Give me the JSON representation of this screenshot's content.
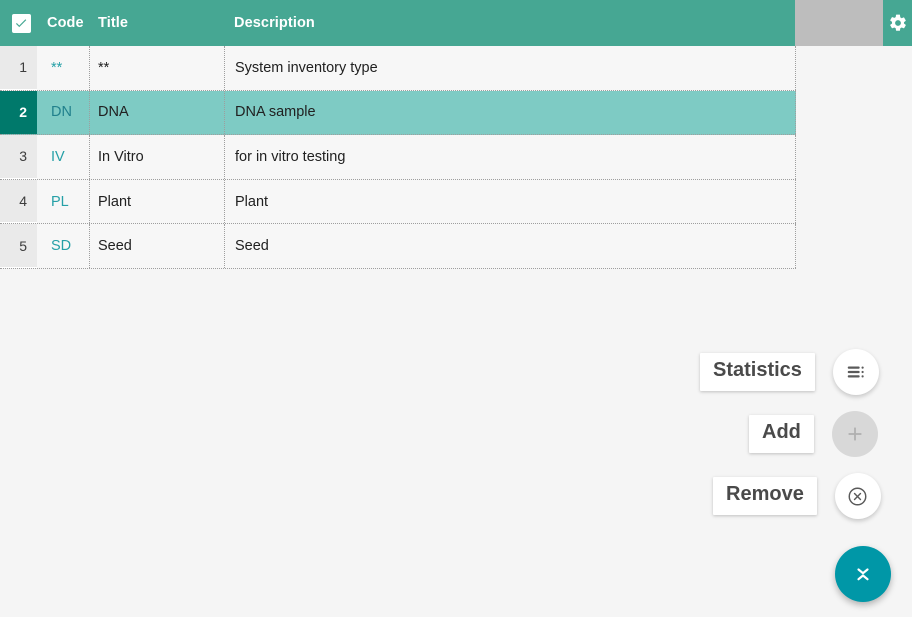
{
  "header": {
    "select_all_checkbox": "checked",
    "columns": [
      {
        "key": "code",
        "label": "Code"
      },
      {
        "key": "title",
        "label": "Title"
      },
      {
        "key": "description",
        "label": "Description"
      }
    ],
    "settings_icon": "gear-icon",
    "bar_color": "#46a793",
    "placeholder_block_color": "#bdbdbd"
  },
  "table": {
    "selected_row_number": 2,
    "selected_row_color": "#7ecbc4",
    "selected_number_color": "#00796b",
    "code_link_color": "#26a0a7",
    "rows": [
      {
        "num": "1",
        "code": "**",
        "title": "**",
        "description": "System inventory type"
      },
      {
        "num": "2",
        "code": "DN",
        "title": "DNA",
        "description": "DNA sample"
      },
      {
        "num": "3",
        "code": "IV",
        "title": "In Vitro",
        "description": "for in vitro testing"
      },
      {
        "num": "4",
        "code": "PL",
        "title": "Plant",
        "description": "Plant"
      },
      {
        "num": "5",
        "code": "SD",
        "title": "Seed",
        "description": "Seed"
      }
    ]
  },
  "actions": {
    "statistics": {
      "label": "Statistics",
      "icon": "list-lines-icon",
      "enabled": true
    },
    "add": {
      "label": "Add",
      "icon": "plus-icon",
      "enabled": false
    },
    "remove": {
      "label": "Remove",
      "icon": "circle-x-icon",
      "enabled": true
    },
    "collapse": {
      "icon": "collapse-chevrons-icon",
      "color": "#0097a7"
    }
  }
}
